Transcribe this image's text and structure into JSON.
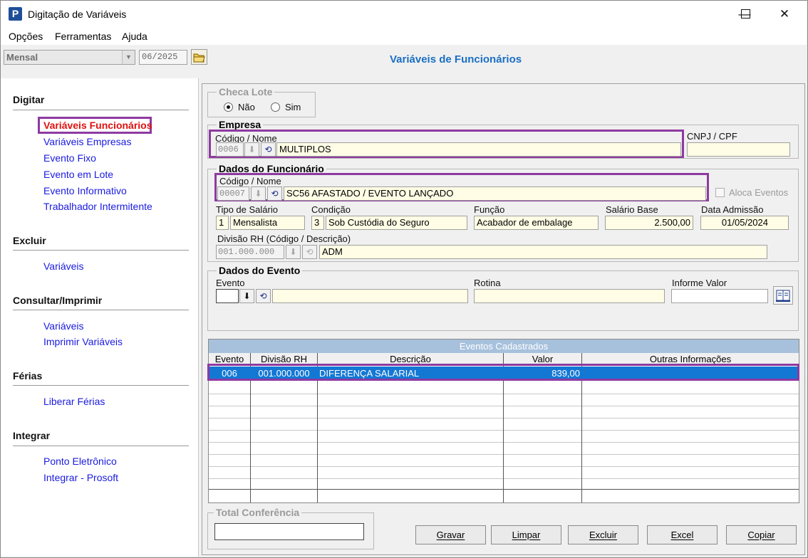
{
  "window": {
    "title": "Digitação de Variáveis",
    "app_icon": "P",
    "min_glyph": "—",
    "max_glyph": "☐",
    "close_glyph": "✕"
  },
  "menu": [
    "Opções",
    "Ferramentas",
    "Ajuda"
  ],
  "toolbar": {
    "period_type": "Mensal",
    "period_value": "06/2025",
    "page_title": "Variáveis de Funcionários"
  },
  "sidebar": {
    "digitar": {
      "heading": "Digitar",
      "items": [
        "Variáveis Funcionários",
        "Variáveis Empresas",
        "Evento Fixo",
        "Evento em Lote",
        "Evento Informativo",
        "Trabalhador Intermitente"
      ]
    },
    "excluir": {
      "heading": "Excluir",
      "items": [
        "Variáveis"
      ]
    },
    "consultar": {
      "heading": "Consultar/Imprimir",
      "items": [
        "Variáveis",
        "Imprimir Variáveis"
      ]
    },
    "ferias": {
      "heading": "Férias",
      "items": [
        "Liberar Férias"
      ]
    },
    "integrar": {
      "heading": "Integrar",
      "items": [
        "Ponto Eletrônico",
        "Integrar - Prosoft"
      ]
    }
  },
  "checa_lote": {
    "legend": "Checa Lote",
    "option_nao": "Não",
    "option_sim": "Sim",
    "selected": "Não"
  },
  "empresa": {
    "legend": "Empresa",
    "code_label": "Código / Nome",
    "code": "0006",
    "name": "MULTIPLOS",
    "cnpj_label": "CNPJ / CPF",
    "cnpj": ""
  },
  "funcionario": {
    "legend": "Dados do Funcionário",
    "code_label": "Código / Nome",
    "code": "00007",
    "name": "SC56 AFASTADO / EVENTO LANÇADO",
    "aloca_label": "Aloca Eventos",
    "tipo_salario_label": "Tipo de Salário",
    "tipo_salario_code": "1",
    "tipo_salario": "Mensalista",
    "condicao_label": "Condição",
    "condicao_code": "3",
    "condicao": "Sob Custódia do Seguro",
    "funcao_label": "Função",
    "funcao": "Acabador de embalage",
    "salario_label": "Salário Base",
    "salario": "2.500,00",
    "admissao_label": "Data Admissão",
    "admissao": "01/05/2024",
    "divisao_label": "Divisão RH (Código / Descrição)",
    "divisao_code": "001.000.000",
    "divisao": "ADM"
  },
  "evento": {
    "legend": "Dados do Evento",
    "evento_label": "Evento",
    "evento_code": "",
    "evento_desc": "",
    "rotina_label": "Rotina",
    "rotina": "",
    "valor_label": "Informe Valor",
    "valor": ""
  },
  "grid": {
    "caption": "Eventos Cadastrados",
    "columns": [
      "Evento",
      "Divisão RH",
      "Descrição",
      "Valor",
      "Outras Informações"
    ],
    "rows": [
      [
        "006",
        "001.000.000",
        "DIFERENÇA SALARIAL",
        "839,00",
        ""
      ]
    ]
  },
  "total": {
    "legend": "Total Conferência",
    "value": ""
  },
  "buttons": [
    "Gravar",
    "Limpar",
    "Excluir",
    "Excel",
    "Copiar"
  ],
  "colors": {
    "link": "#1a1ae0",
    "active_link": "#e01010",
    "title": "#1a6fc4",
    "highlight": "#8e3aa0",
    "selection": "#1378d4"
  }
}
